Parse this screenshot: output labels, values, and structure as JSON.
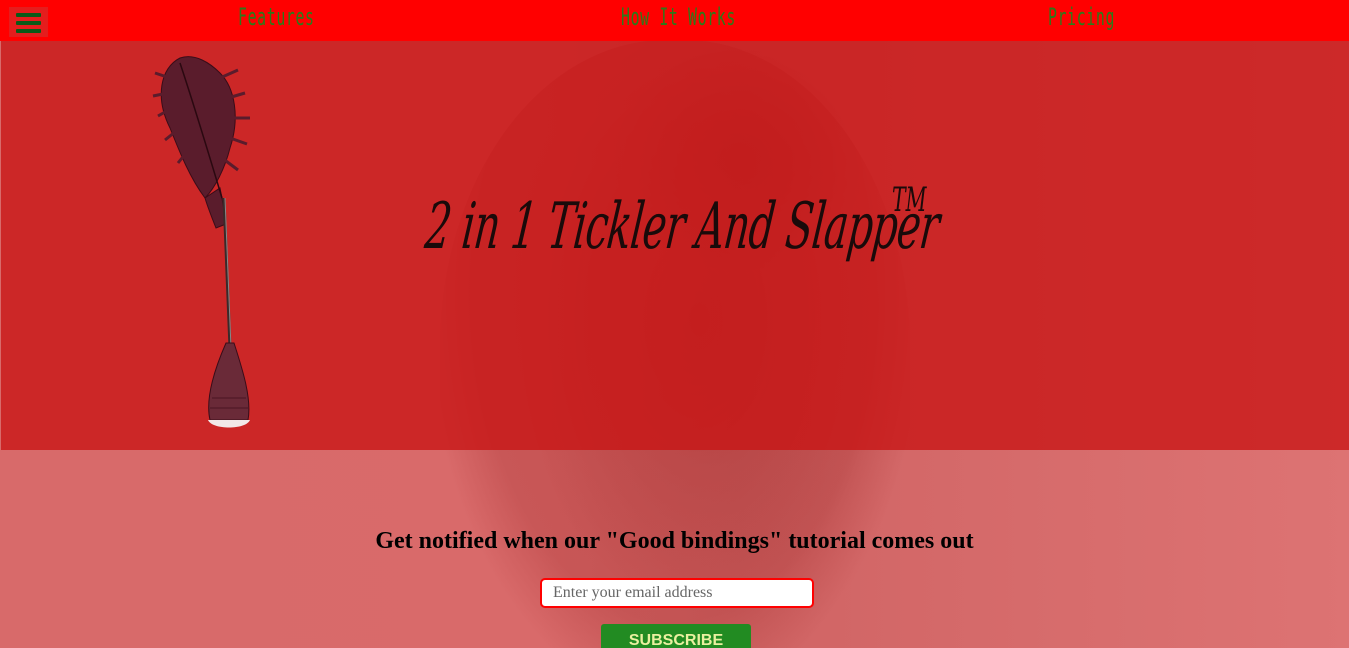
{
  "nav": {
    "menu_icon": "hamburger-menu-icon",
    "links": [
      {
        "label": "Features"
      },
      {
        "label": "How It Works"
      },
      {
        "label": "Pricing"
      }
    ]
  },
  "hero": {
    "logo_text": "2 in 1 Tickler And Slapper",
    "trademark": "TM",
    "product_image": "feather-tickler-image"
  },
  "signup": {
    "heading": "Get notified when our \"Good bindings\" tutorial comes out",
    "email_placeholder": "Enter your email address",
    "subscribe_label": "SUBSCRIBE"
  },
  "colors": {
    "nav_background": "#ff0000",
    "nav_text": "#2b7a1a",
    "hero_overlay": "#c81414",
    "button_background": "#228b22",
    "button_text": "#eaf0a0",
    "input_border": "#ff0000"
  }
}
